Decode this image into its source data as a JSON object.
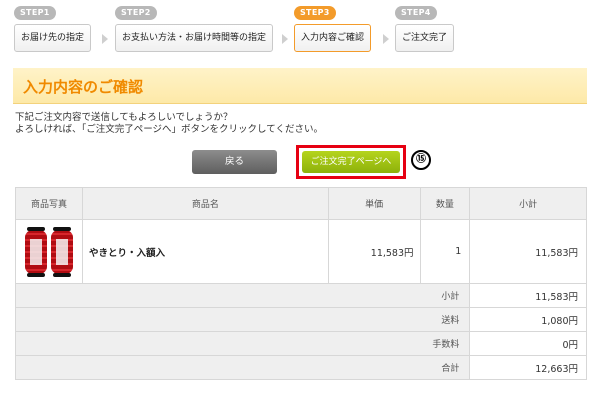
{
  "steps": [
    {
      "tag": "STEP1",
      "label": "お届け先の指定"
    },
    {
      "tag": "STEP2",
      "label": "お支払い方法・お届け時間等の指定"
    },
    {
      "tag": "STEP3",
      "label": "入力内容ご確認"
    },
    {
      "tag": "STEP4",
      "label": "ご注文完了"
    }
  ],
  "title": "入力内容のご確認",
  "notice": "下記ご注文内容で送信してもよろしいでしょうか？\nよろしければ、「ご注文完了ページへ」ボタンをクリックしてください。",
  "buttons": {
    "back": "戻る",
    "confirm": "ご注文完了ページへ",
    "marker": "⑮"
  },
  "table": {
    "headers": [
      "商品写真",
      "商品名",
      "単価",
      "数量",
      "小計"
    ],
    "item": {
      "name": "やきとり・入額入",
      "price": "11,583円",
      "qty": "1",
      "subtotal": "11,583円"
    },
    "summary": [
      {
        "label": "小計",
        "value": "11,583円"
      },
      {
        "label": "送料",
        "value": "1,080円"
      },
      {
        "label": "手数料",
        "value": "0円"
      },
      {
        "label": "合計",
        "value": "12,663円"
      }
    ]
  },
  "colors": {
    "accent": "#f39b2a",
    "title": "#f08a00",
    "confirm": "#9cbf12",
    "highlight": "#e60012"
  }
}
